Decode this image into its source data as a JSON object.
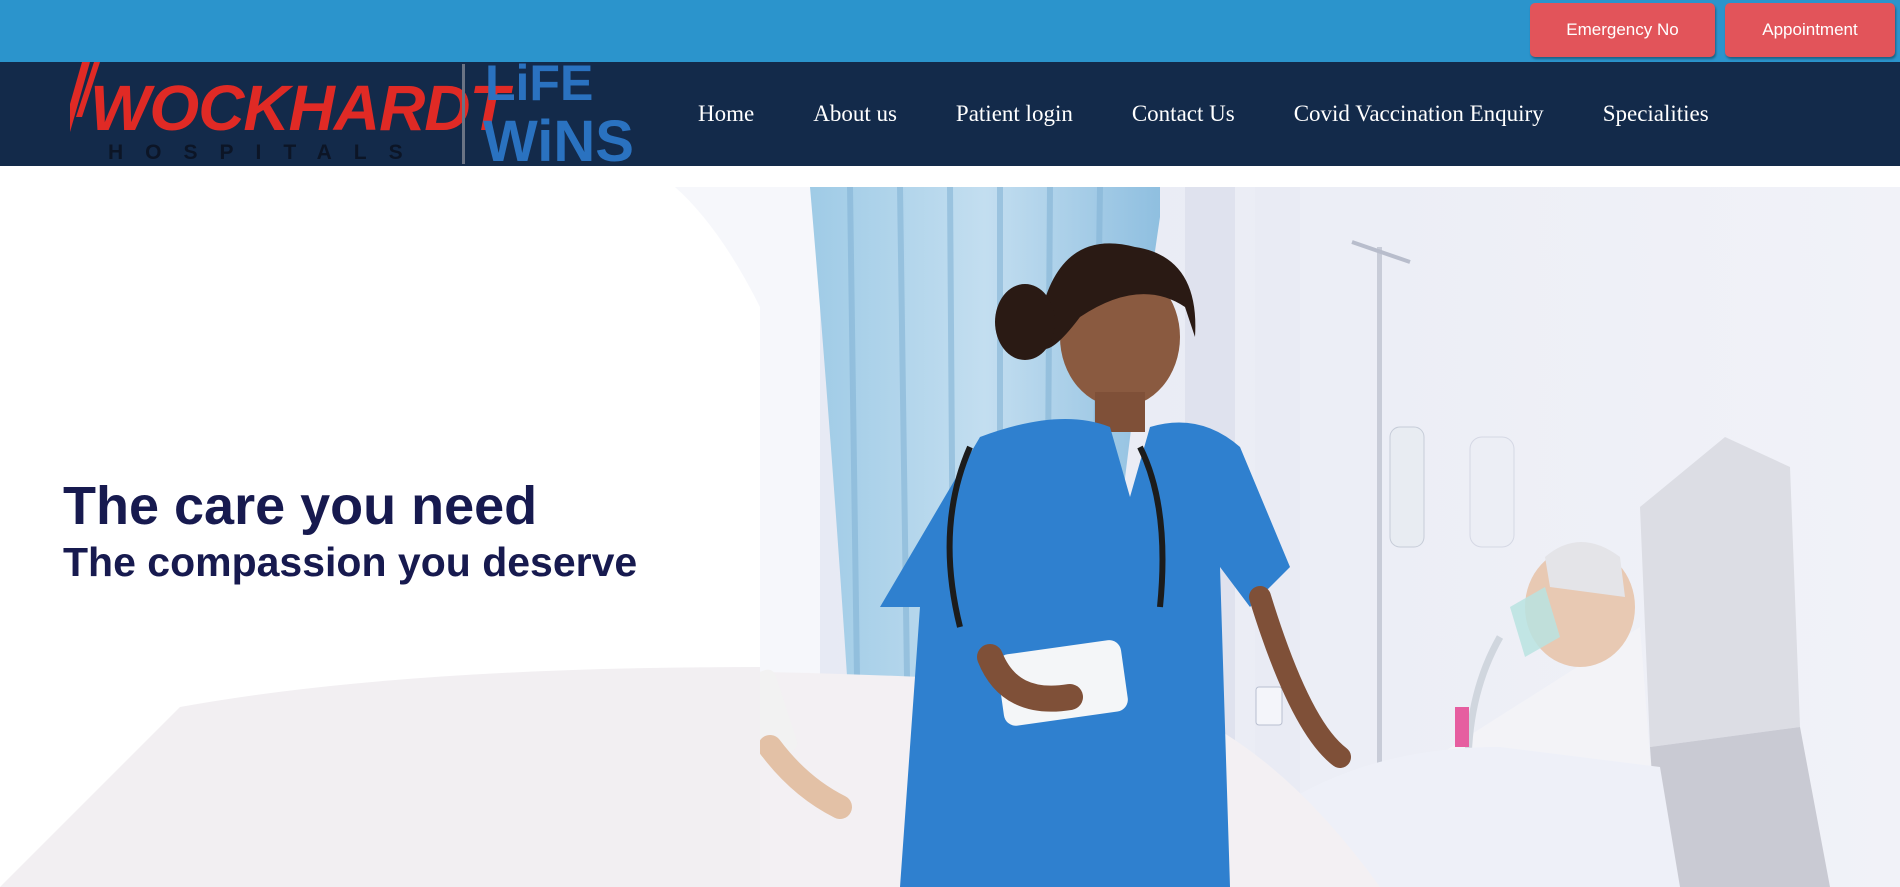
{
  "topbar": {
    "emergency_label": "Emergency No",
    "appointment_label": "Appointment"
  },
  "logo": {
    "brand": "WOCKHARDT",
    "tagline": "HOSPITALS",
    "slogan_top": "LiFE",
    "slogan_bottom": "WiNS"
  },
  "nav": {
    "items": [
      {
        "label": "Home"
      },
      {
        "label": "About us"
      },
      {
        "label": "Patient login"
      },
      {
        "label": "Contact Us"
      },
      {
        "label": "Covid Vaccination Enquiry"
      },
      {
        "label": "Specialities"
      }
    ]
  },
  "hero": {
    "title": "The care you need",
    "subtitle": "The compassion you deserve"
  },
  "colors": {
    "topbar": "#2b94cc",
    "navbar": "#132a4a",
    "button": "#e2545a",
    "brand_red": "#e02a25",
    "slogan_blue": "#2a72c0",
    "hero_text": "#171a4f"
  }
}
